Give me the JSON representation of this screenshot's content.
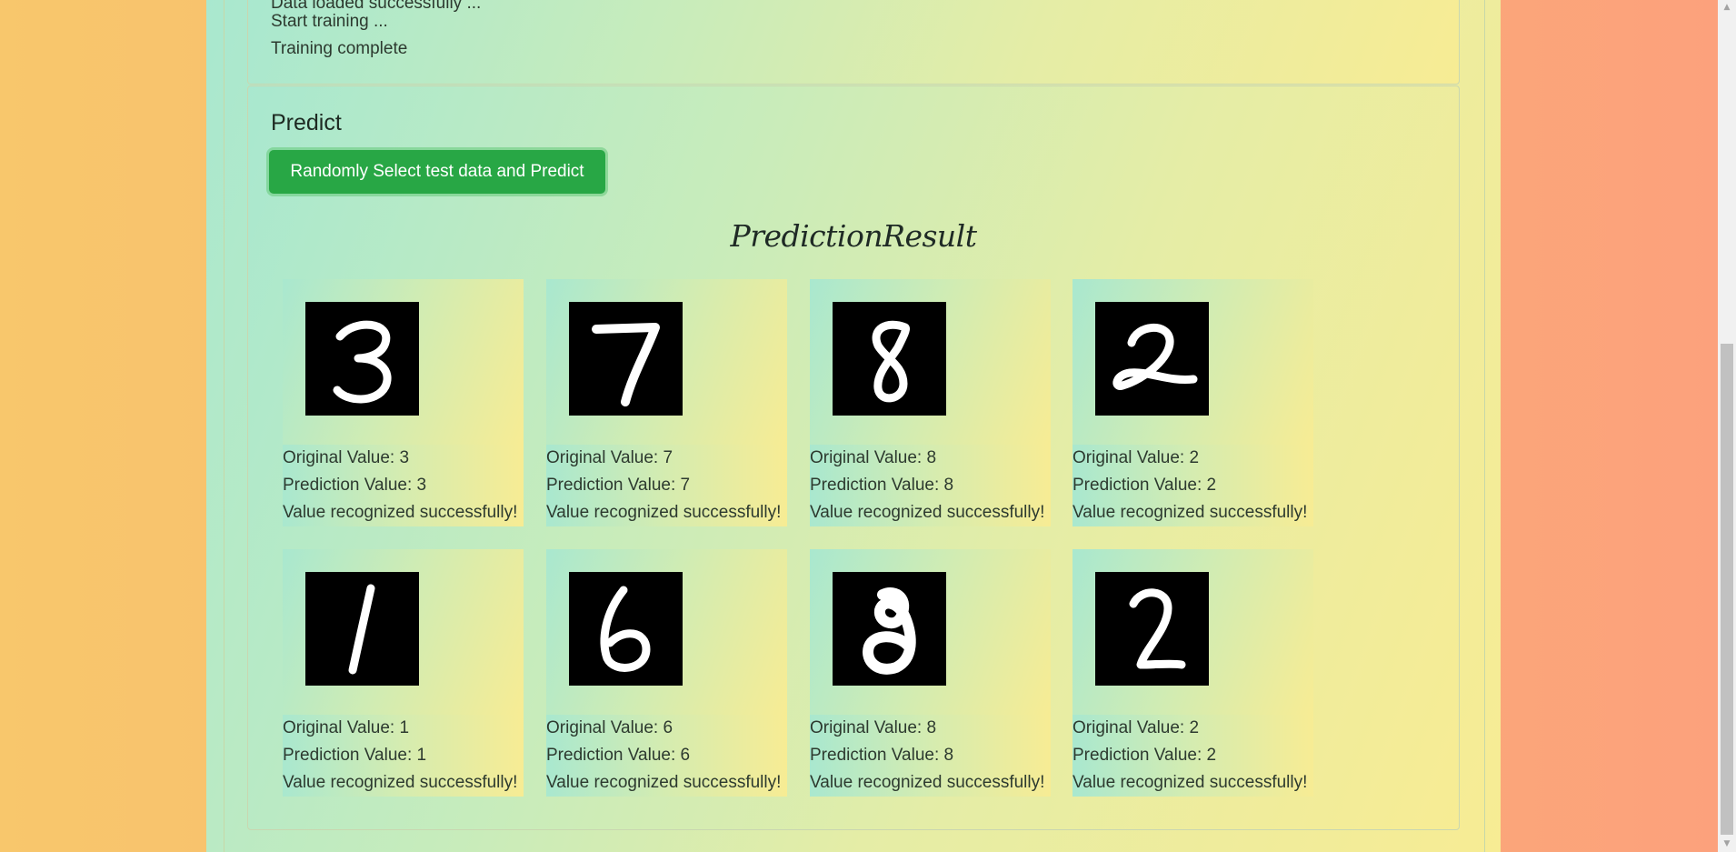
{
  "training_log": {
    "lines": [
      "Data loaded successfully ...",
      "Start training ...",
      "Training complete"
    ]
  },
  "predict": {
    "title": "Predict",
    "button_label": "Randomly Select test data and Predict",
    "result_title": "PredictionResult"
  },
  "results": [
    {
      "digit": "3",
      "original": "Original Value: 3",
      "prediction": "Prediction Value: 3",
      "status": "Value recognized successfully!"
    },
    {
      "digit": "7",
      "original": "Original Value: 7",
      "prediction": "Prediction Value: 7",
      "status": "Value recognized successfully!"
    },
    {
      "digit": "8",
      "original": "Original Value: 8",
      "prediction": "Prediction Value: 8",
      "status": "Value recognized successfully!"
    },
    {
      "digit": "2",
      "original": "Original Value: 2",
      "prediction": "Prediction Value: 2",
      "status": "Value recognized successfully!"
    },
    {
      "digit": "1",
      "original": "Original Value: 1",
      "prediction": "Prediction Value: 1",
      "status": "Value recognized successfully!"
    },
    {
      "digit": "6",
      "original": "Original Value: 6",
      "prediction": "Prediction Value: 6",
      "status": "Value recognized successfully!"
    },
    {
      "digit": "8",
      "original": "Original Value: 8",
      "prediction": "Prediction Value: 8",
      "status": "Value recognized successfully!"
    },
    {
      "digit": "2",
      "original": "Original Value: 2",
      "prediction": "Prediction Value: 2",
      "status": "Value recognized successfully!"
    }
  ],
  "colors": {
    "button": "#28a745",
    "digit_background": "#000000",
    "digit_stroke": "#ffffff"
  }
}
